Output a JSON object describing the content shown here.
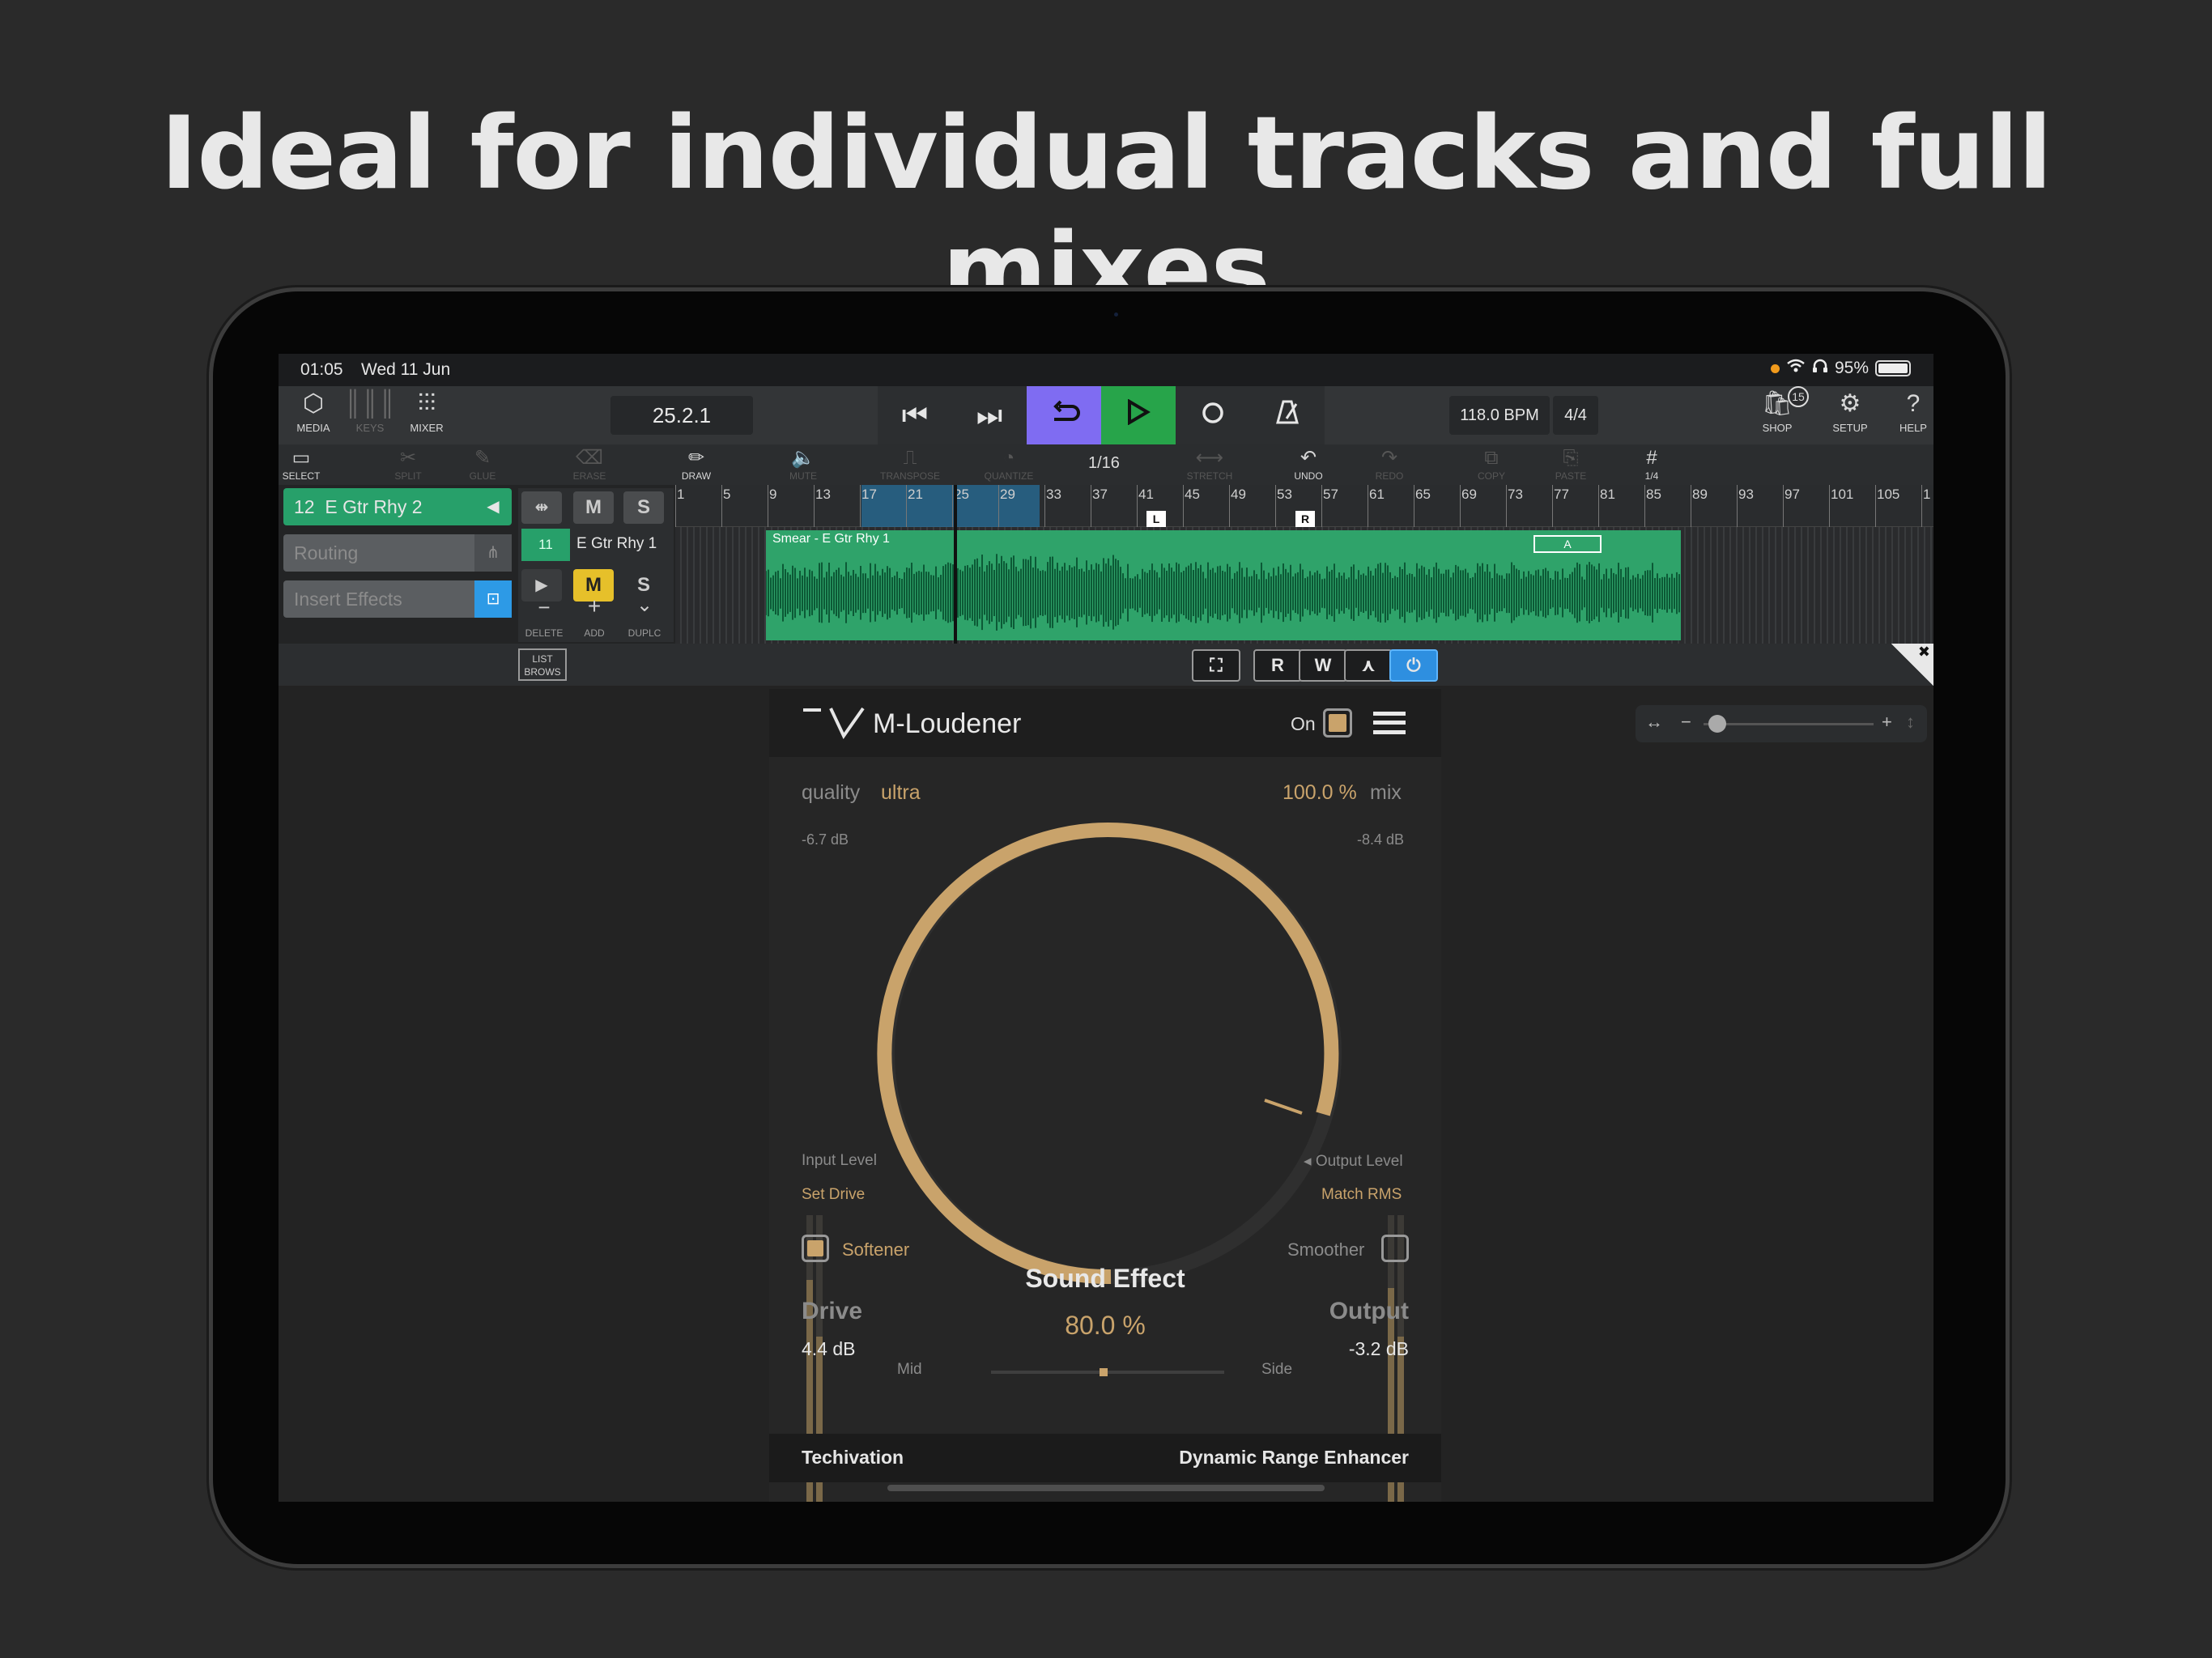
{
  "headline": "Ideal for individual tracks and full mixes",
  "status_bar": {
    "time": "01:05",
    "date": "Wed 11 Jun",
    "battery": "95%"
  },
  "toolbar": {
    "media": "MEDIA",
    "keys": "KEYS",
    "mixer": "MIXER",
    "position": "25.2.1",
    "bpm": "118.0 BPM",
    "time_signature": "4/4",
    "shop": "SHOP",
    "shop_badge": "15",
    "setup": "SETUP",
    "help": "HELP"
  },
  "tools": {
    "select": "SELECT",
    "split": "SPLIT",
    "glue": "GLUE",
    "erase": "ERASE",
    "draw": "DRAW",
    "mute": "MUTE",
    "transpose": "TRANSPOSE",
    "quantize": "QUANTIZE",
    "quantize_value": "1/16",
    "stretch": "STRETCH",
    "undo": "UNDO",
    "redo": "REDO",
    "copy": "COPY",
    "paste": "PASTE",
    "grid": "1/4"
  },
  "tracks": {
    "selected": {
      "number": "12",
      "name": "E Gtr Rhy 2"
    },
    "routing": "Routing",
    "insert_effects": "Insert Effects",
    "lane": {
      "number": "11",
      "name": "E Gtr Rhy 1",
      "mute": "M",
      "solo": "S",
      "delete": "DELETE",
      "add": "ADD",
      "duplicate": "DUPLC"
    },
    "header_mute": "M",
    "header_solo": "S"
  },
  "ruler": [
    "1",
    "5",
    "9",
    "13",
    "17",
    "21",
    "25",
    "29",
    "33",
    "37",
    "41",
    "45",
    "49",
    "53",
    "57",
    "61",
    "65",
    "69",
    "73",
    "77",
    "81",
    "85",
    "89",
    "93",
    "97",
    "101",
    "105",
    "1"
  ],
  "loop_markers": {
    "left": "L",
    "right": "R"
  },
  "clip": {
    "name": "Smear - E Gtr Rhy 1",
    "marker": "A"
  },
  "editor_bar": {
    "list_browser": "LIST BROWS",
    "read": "R",
    "write": "W"
  },
  "plugin": {
    "name": "M-Loudener",
    "on_label": "On",
    "quality_label": "quality",
    "quality_value": "ultra",
    "mix_value": "100.0 %",
    "mix_label": "mix",
    "input_db": "-6.7 dB",
    "output_db": "-8.4 dB",
    "input_level_label": "Input Level",
    "output_level_label": "Output Level",
    "set_drive": "Set Drive",
    "match_rms": "Match RMS",
    "softener_label": "Softener",
    "smoother_label": "Smoother",
    "sound_effect_label": "Sound Effect",
    "sound_effect_value": "80.0 %",
    "drive_label": "Drive",
    "drive_value": "4.4 dB",
    "output_label": "Output",
    "output_value": "-3.2 dB",
    "mid_label": "Mid",
    "side_label": "Side",
    "vendor": "Techivation",
    "tagline": "Dynamic Range Enhancer"
  },
  "colors": {
    "gold": "#c9a36b",
    "loop": "#7f6cf2",
    "play": "#27a44a",
    "track_green": "#27a06a",
    "power_blue": "#2e8fe0"
  }
}
